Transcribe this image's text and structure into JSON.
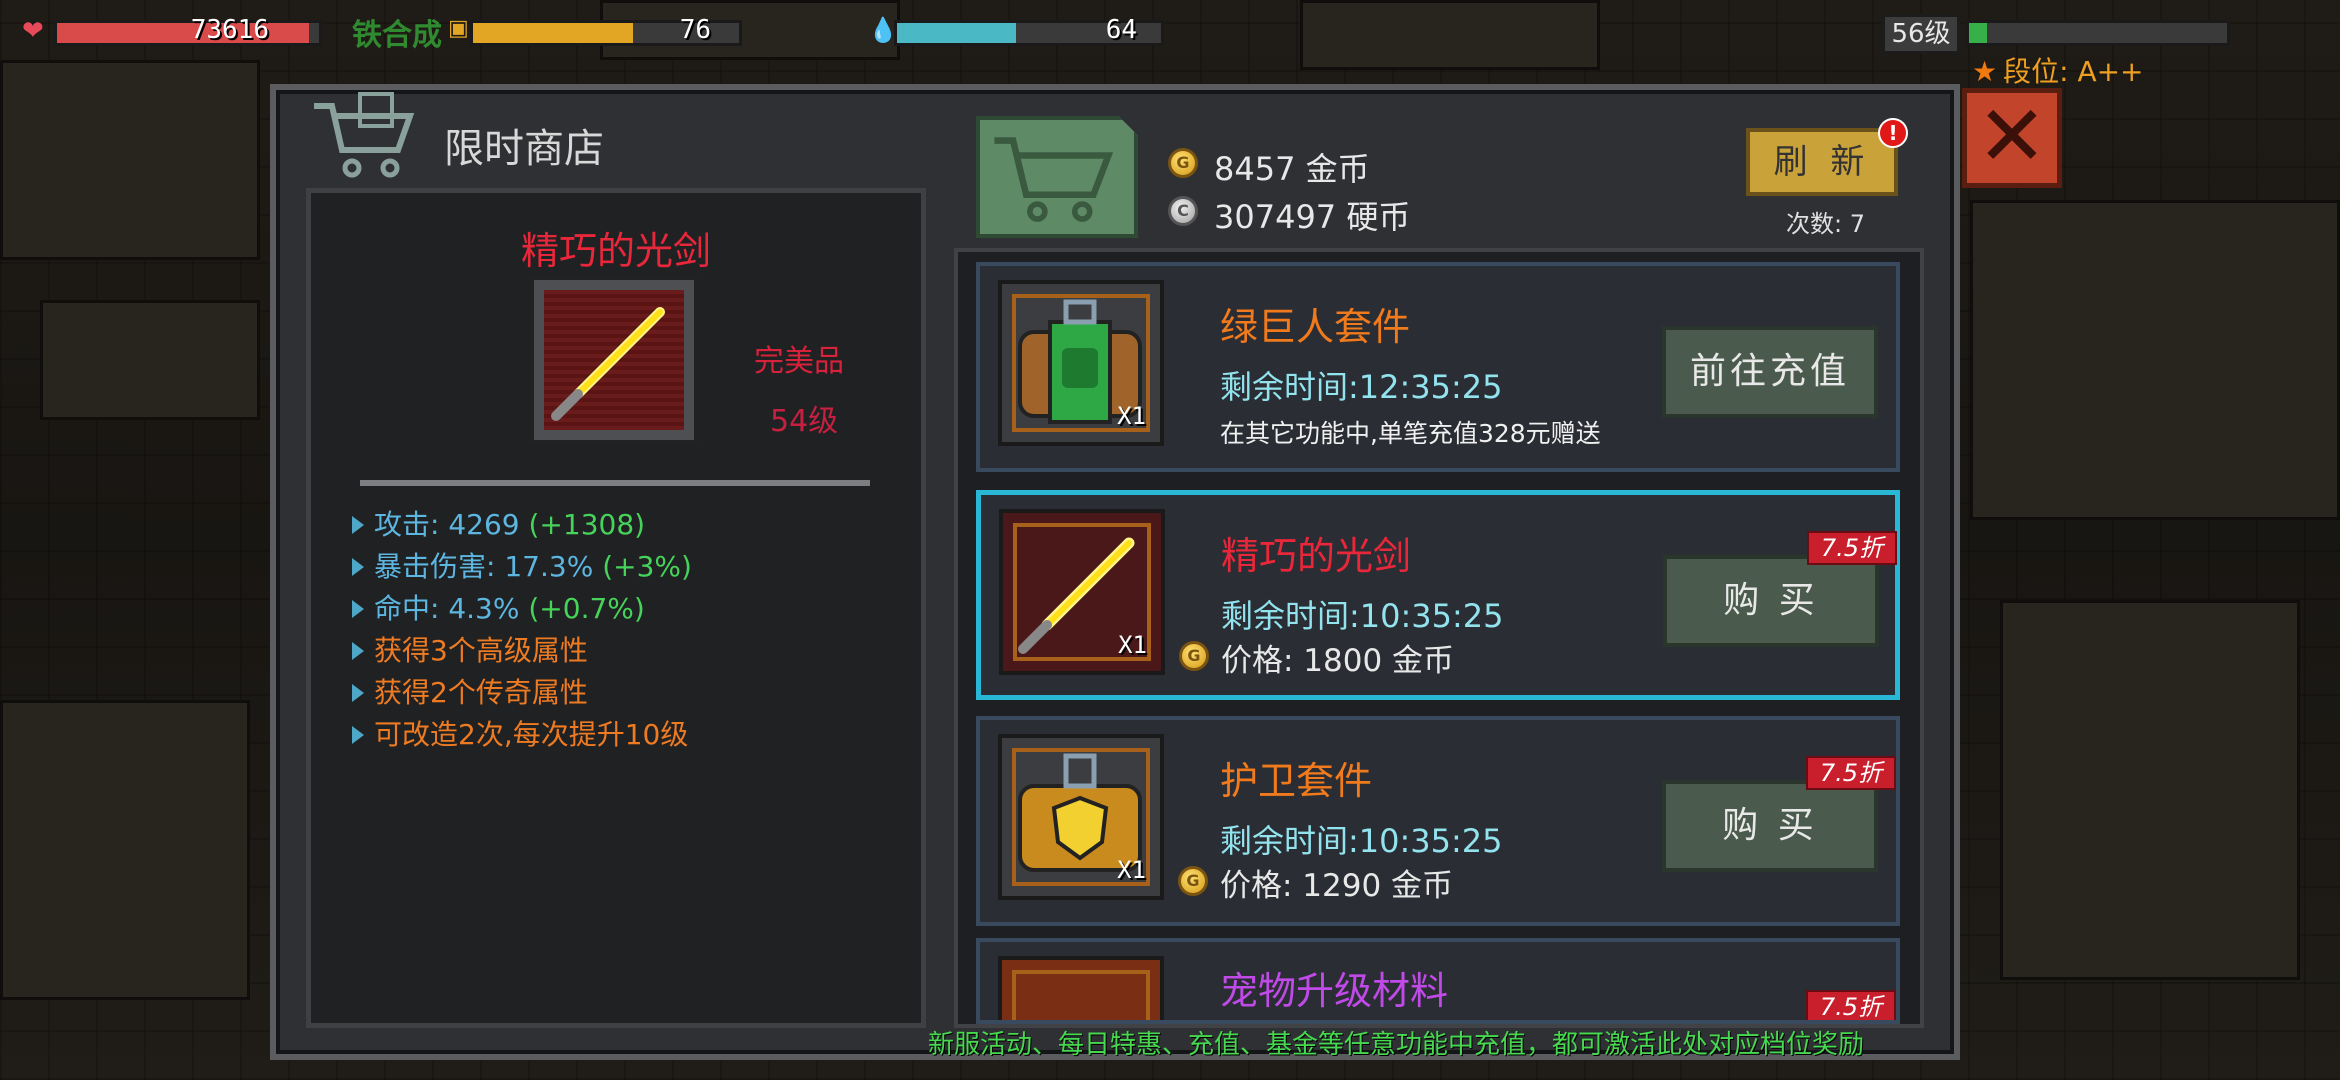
{
  "hud": {
    "hp_value": "73616",
    "fusion_label": "铁合成",
    "energy_value": "76",
    "water_value": "64",
    "level": "56级",
    "rank": "段位: A++"
  },
  "shop": {
    "title": "限时商店",
    "gold": "8457 金币",
    "coins": "307497 硬币",
    "refresh_label": "刷 新",
    "alert": "!",
    "refresh_count": "次数: 7",
    "close_icon": "close-icon",
    "footer_note": "新服活动、每日特惠、充值、基金等任意功能中充值，都可激活此处对应档位奖励"
  },
  "detail": {
    "name": "精巧的光剑",
    "quality": "完美品",
    "level": "54级",
    "stats": [
      {
        "label": "攻击: ",
        "value": "4269",
        "bonus": " (+1308)"
      },
      {
        "label": "暴击伤害: ",
        "value": "17.3%",
        "bonus": " (+3%)"
      },
      {
        "label": "命中: ",
        "value": "4.3%",
        "bonus": " (+0.7%)"
      }
    ],
    "effects": [
      "获得3个高级属性",
      "获得2个传奇属性",
      "可改造2次,每次提升10级"
    ]
  },
  "items": [
    {
      "name": "绿巨人套件",
      "name_color": "#f07a1c",
      "timer": "剩余时间:12:35:25",
      "note": "在其它功能中,单笔充值328元赠送",
      "action": "前往充值",
      "qty": "X1"
    },
    {
      "name": "精巧的光剑",
      "name_color": "#e8273a",
      "timer": "剩余时间:10:35:25",
      "price": "价格: 1800 金币",
      "action": "购 买",
      "discount": "7.5折",
      "qty": "X1"
    },
    {
      "name": "护卫套件",
      "name_color": "#f07a1c",
      "timer": "剩余时间:10:35:25",
      "price": "价格: 1290 金币",
      "action": "购 买",
      "discount": "7.5折",
      "qty": "X1"
    },
    {
      "name": "宠物升级材料",
      "name_color": "#c04ae8",
      "discount": "7.5折"
    }
  ],
  "colors": {
    "hp": "#d94a4a",
    "energy": "#e2a524",
    "water": "#4bb8c6",
    "accent_selected": "#29b7d6"
  }
}
